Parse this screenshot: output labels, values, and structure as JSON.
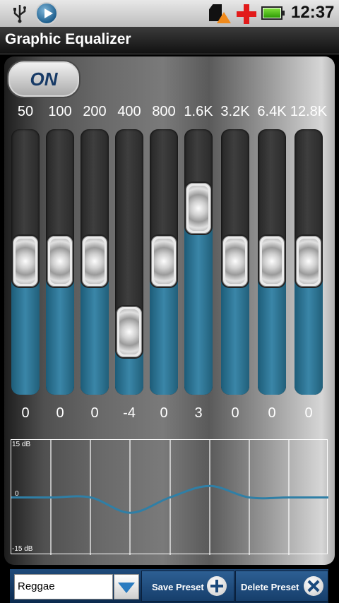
{
  "status_bar": {
    "time": "12:37"
  },
  "app": {
    "title": "Graphic Equalizer"
  },
  "power_toggle": {
    "label": "ON"
  },
  "bands": [
    {
      "freq": "50",
      "value": "0",
      "db": 0
    },
    {
      "freq": "100",
      "value": "0",
      "db": 0
    },
    {
      "freq": "200",
      "value": "0",
      "db": 0
    },
    {
      "freq": "400",
      "value": "-4",
      "db": -4
    },
    {
      "freq": "800",
      "value": "0",
      "db": 0
    },
    {
      "freq": "1.6K",
      "value": "3",
      "db": 3
    },
    {
      "freq": "3.2K",
      "value": "0",
      "db": 0
    },
    {
      "freq": "6.4K",
      "value": "0",
      "db": 0
    },
    {
      "freq": "12.8K",
      "value": "0",
      "db": 0
    }
  ],
  "graph": {
    "top_label": "15 dB",
    "mid_label": "0",
    "bottom_label": "-15 dB",
    "curve_color": "#2f7fa6"
  },
  "preset": {
    "selected": "Reggae"
  },
  "buttons": {
    "save_preset": "Save Preset",
    "delete_preset": "Delete Preset"
  },
  "colors": {
    "fill": "#2f7fa6",
    "bottom_bar": "#1b4a7d"
  }
}
